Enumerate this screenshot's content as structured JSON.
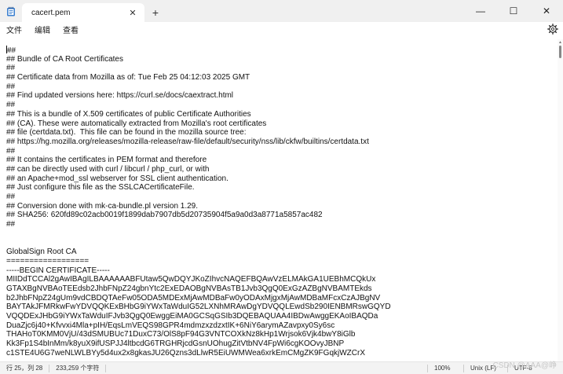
{
  "tab": {
    "title": "cacert.pem",
    "close_glyph": "✕",
    "new_tab_glyph": "+"
  },
  "window": {
    "minimize": "—",
    "maximize": "☐",
    "close": "✕"
  },
  "menu": {
    "file": "文件",
    "edit": "编辑",
    "view": "查看"
  },
  "editor": {
    "lines": [
      "##",
      "## Bundle of CA Root Certificates",
      "##",
      "## Certificate data from Mozilla as of: Tue Feb 25 04:12:03 2025 GMT",
      "##",
      "## Find updated versions here: https://curl.se/docs/caextract.html",
      "##",
      "## This is a bundle of X.509 certificates of public Certificate Authorities",
      "## (CA). These were automatically extracted from Mozilla's root certificates",
      "## file (certdata.txt).  This file can be found in the mozilla source tree:",
      "## https://hg.mozilla.org/releases/mozilla-release/raw-file/default/security/nss/lib/ckfw/builtins/certdata.txt",
      "##",
      "## It contains the certificates in PEM format and therefore",
      "## can be directly used with curl / libcurl / php_curl, or with",
      "## an Apache+mod_ssl webserver for SSL client authentication.",
      "## Just configure this file as the SSLCACertificateFile.",
      "##",
      "## Conversion done with mk-ca-bundle.pl version 1.29.",
      "## SHA256: 620fd89c02acb0019f1899dab7907db5d20735904f5a9a0d3a8771a5857ac482",
      "##",
      "",
      "",
      "GlobalSign Root CA",
      "==================",
      "-----BEGIN CERTIFICATE-----",
      "MIIDdTCCAl2gAwIBAgILBAAAAAABFUtaw5QwDQYJKoZIhvcNAQEFBQAwVzELMAkGA1UEBhMCQkUx",
      "GTAXBgNVBAoTEEdsb2JhbFNpZ24gbnYtc2ExEDAOBgNVBAsTB1Jvb3QgQ0ExGzAZBgNVBAMTEkds",
      "b2JhbFNpZ24gUm9vdCBDQTAeFw05ODA5MDExMjAwMDBaFw0yODAxMjgxMjAwMDBaMFcxCzAJBgNV",
      "BAYTAkJFMRkwFwYDVQQKExBHbG9iYWxTaWduIG52LXNhMRAwDgYDVQQLEwdSb290IENBMRswGQYD",
      "VQQDExJHbG9iYWxTaWduIFJvb3QgQ0EwggEiMA0GCSqGSIb3DQEBAQUAA4IBDwAwggEKAoIBAQDa",
      "DuaZjc6j40+Kfvvxi4Mla+pIH/EqsLmVEQS98GPR4mdmzxzdzxtIK+6NiY6arymAZavpxy0Sy6sc",
      "THAHoT0KMM0VjU/43dSMUBUc71DuxC73/OlS8pF94G3VNTCOXkNz8kHp1Wrjsok6Vjk4bwY8iGlb",
      "Kk3Fp1S4bInMm/k8yuX9ifUSPJJ4ltbcdG6TRGHRjcdGsnUOhugZitVtbNV4FpWi6cgKOOvyJBNP",
      "c1STE4U6G7weNLWLBYy5d4ux2x8gkasJU26Qzns3dLlwR5EiUWMWea6xrkEmCMgZK9FGqkjWZCrX"
    ]
  },
  "status": {
    "position": "行 25，列 28",
    "chars": "233,259 个字符",
    "zoom": "100%",
    "eol": "Unix (LF)",
    "encoding": "UTF-8"
  },
  "watermark": "CSDN @AAA@峥"
}
